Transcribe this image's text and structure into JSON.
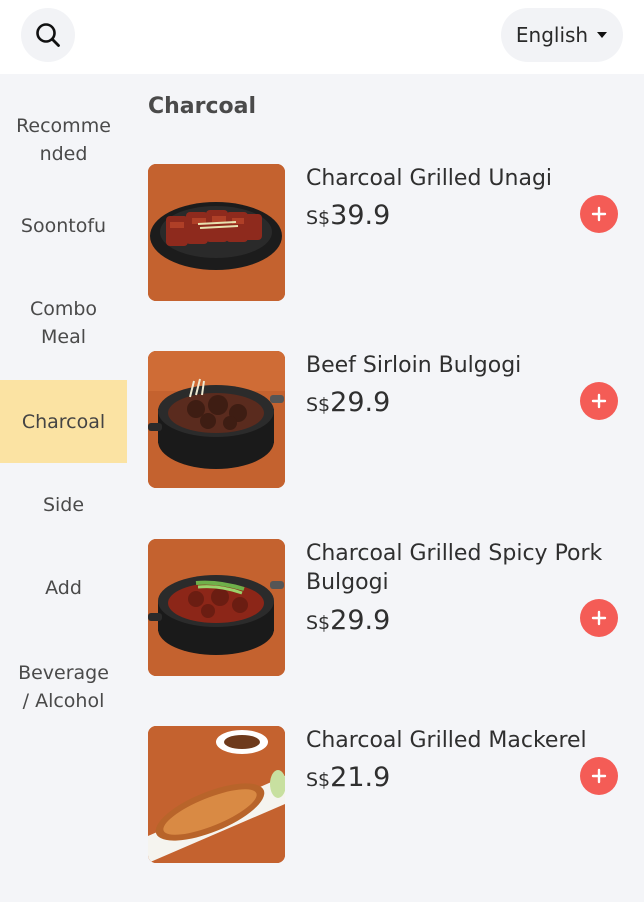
{
  "header": {
    "language_label": "English"
  },
  "sidebar": {
    "items": [
      {
        "label": "Recomme\nnded"
      },
      {
        "label": "Soontofu"
      },
      {
        "label": "Combo\nMeal"
      },
      {
        "label": "Charcoal"
      },
      {
        "label": "Side"
      },
      {
        "label": "Add"
      },
      {
        "label": "Beverage\n/ Alcohol"
      }
    ],
    "active_index": 3
  },
  "main": {
    "section_title": "Charcoal",
    "dishes": [
      {
        "name": "Charcoal Grilled Unagi",
        "currency": "S$",
        "price": "39.9"
      },
      {
        "name": "Beef Sirloin Bulgogi",
        "currency": "S$",
        "price": "29.9"
      },
      {
        "name": "Charcoal Grilled Spicy Pork Bulgogi",
        "currency": "S$",
        "price": "29.9"
      },
      {
        "name": "Charcoal Grilled Mackerel",
        "currency": "S$",
        "price": "21.9"
      }
    ]
  },
  "colors": {
    "accent_add": "#f45c56",
    "active_category": "#fbe3a3",
    "panel_bg": "#f4f5f8"
  },
  "icons": {
    "search": "search-icon",
    "dropdown": "caret-down-icon",
    "add": "plus-icon"
  }
}
